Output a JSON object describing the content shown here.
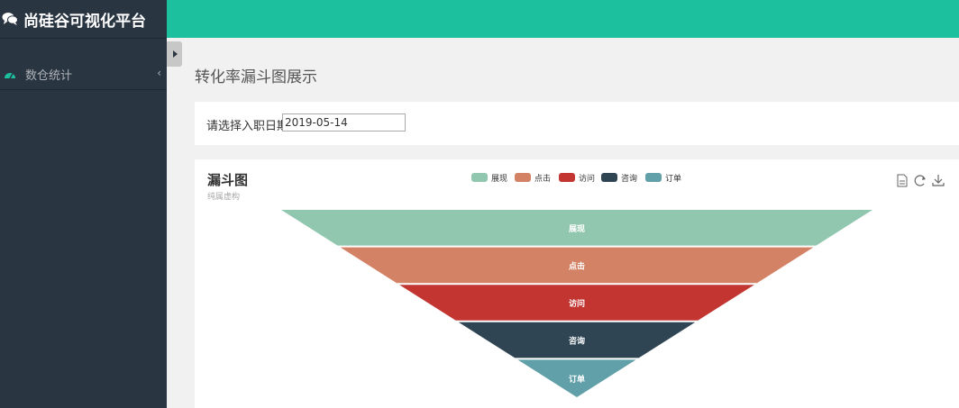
{
  "app": {
    "title": "尚硅谷可视化平台"
  },
  "sidebar": {
    "items": [
      {
        "label": "数仓统计",
        "icon": "dashboard-icon",
        "chevron": "‹"
      }
    ]
  },
  "page": {
    "title": "转化率漏斗图展示"
  },
  "filter": {
    "label": "请选择入职日期",
    "value": "2019-05-14"
  },
  "colors": {
    "topbar": "#1cc09f",
    "sidebar": "#2a3542"
  },
  "chart_data": {
    "type": "funnel",
    "title": "漏斗图",
    "subtitle": "纯属虚构",
    "categories": [
      "展现",
      "点击",
      "访问",
      "咨询",
      "订单"
    ],
    "colors": [
      "#91c7ae",
      "#d48265",
      "#c23531",
      "#2f4554",
      "#61a0a8"
    ],
    "legend_position": "top-center",
    "toolbox": [
      "data-view-icon",
      "restore-icon",
      "save-image-icon"
    ]
  }
}
